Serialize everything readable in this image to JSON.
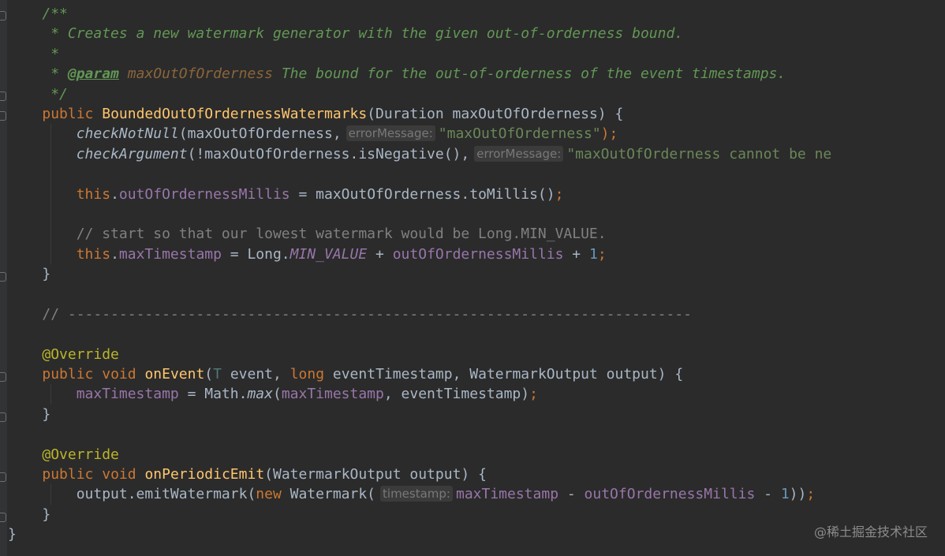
{
  "code": {
    "l1": "/**",
    "l2": " * Creates a new watermark generator with the given out-of-orderness bound.",
    "l3": " *",
    "l4_prefix": " * ",
    "l4_tag": "@param",
    "l4_param": "maxOutOfOrderness",
    "l4_text": " The bound for the out-of-orderness of the event timestamps.",
    "l5": " */",
    "l6_kw": "public",
    "l6_fn": "BoundedOutOfOrdernessWatermarks",
    "l6_rest": "(Duration maxOutOfOrderness) {",
    "l7_call": "checkNotNull",
    "l7_args": "(maxOutOfOrderness,",
    "l7_hint": "errorMessage:",
    "l7_str": "\"maxOutOfOrderness\"",
    "l7_end": ");",
    "l8_call": "checkArgument",
    "l8_args": "(!maxOutOfOrderness.isNegative(),",
    "l8_hint": "errorMessage:",
    "l8_str": "\"maxOutOfOrderness cannot be ne",
    "l10_this": "this",
    "l10_field": "outOfOrdernessMillis",
    "l10_rest": " = maxOutOfOrderness.toMillis()",
    "l10_end": ";",
    "l12": "// start so that our lowest watermark would be Long.MIN_VALUE.",
    "l13_this": "this",
    "l13_field": "maxTimestamp",
    "l13_mid": " = Long.",
    "l13_static": "MIN_VALUE",
    "l13_plus": " + ",
    "l13_field2": "outOfOrdernessMillis",
    "l13_plus2": " + ",
    "l13_num": "1",
    "l13_end": ";",
    "l14": "}",
    "l16": "// -------------------------------------------------------------------------",
    "l18": "@Override",
    "l19_kw1": "public",
    "l19_kw2": "void",
    "l19_fn": "onEvent",
    "l19_open": "(",
    "l19_tp": "T",
    "l19_a": " event, ",
    "l19_kw3": "long",
    "l19_b": " eventTimestamp, WatermarkOutput output) {",
    "l20_field": "maxTimestamp",
    "l20_mid": " = Math.",
    "l20_max": "max",
    "l20_open": "(",
    "l20_field2": "maxTimestamp",
    "l20_rest": ", eventTimestamp)",
    "l20_end": ";",
    "l21": "}",
    "l23": "@Override",
    "l24_kw1": "public",
    "l24_kw2": "void",
    "l24_fn": "onPeriodicEmit",
    "l24_rest": "(WatermarkOutput output) {",
    "l25_a": "output.emitWatermark(",
    "l25_kw": "new",
    "l25_b": " Watermark(",
    "l25_hint": "timestamp:",
    "l25_field": "maxTimestamp",
    "l25_minus": " - ",
    "l25_field2": "outOfOrdernessMillis",
    "l25_minus2": " - ",
    "l25_num": "1",
    "l25_close": "))",
    "l25_end": ";",
    "l26": "}",
    "l27": "}"
  },
  "watermark": "@稀土掘金技术社区"
}
